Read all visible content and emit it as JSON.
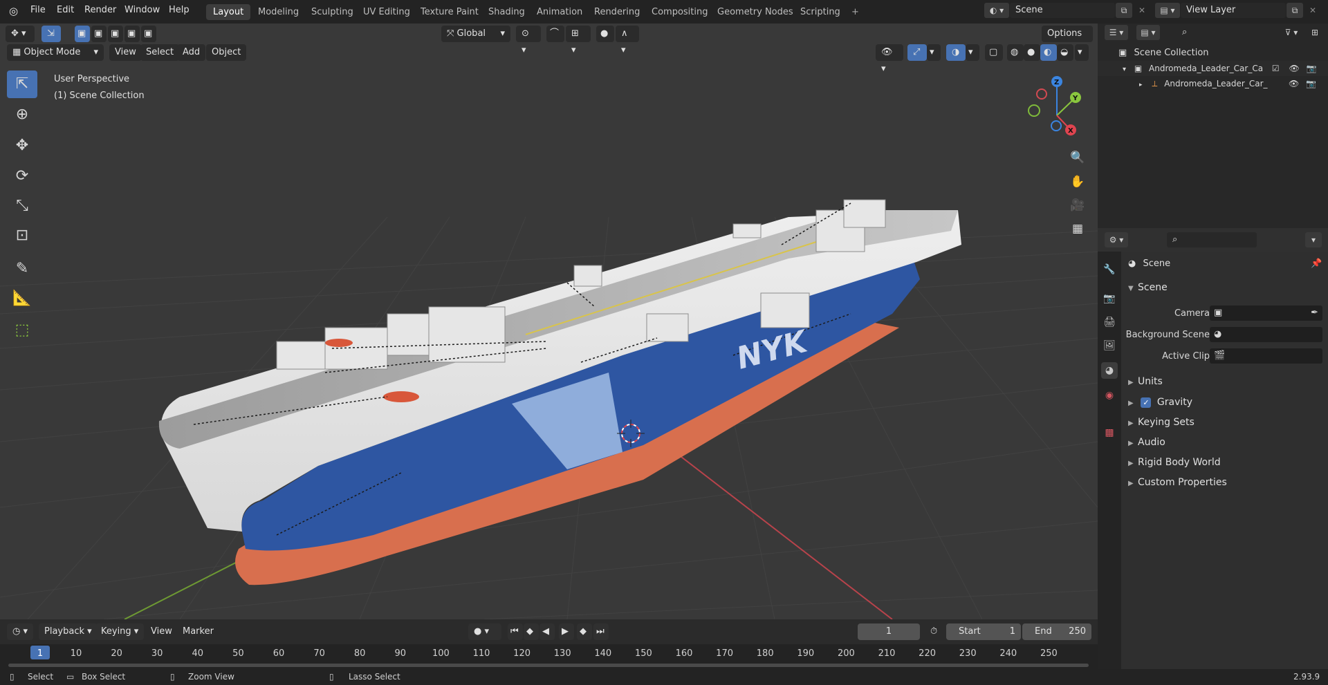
{
  "topbar": {
    "menus": [
      "File",
      "Edit",
      "Render",
      "Window",
      "Help"
    ],
    "workspaces": [
      "Layout",
      "Modeling",
      "Sculpting",
      "UV Editing",
      "Texture Paint",
      "Shading",
      "Animation",
      "Rendering",
      "Compositing",
      "Geometry Nodes",
      "Scripting"
    ],
    "add_tab": "+",
    "scene_name": "Scene",
    "view_layer_name": "View Layer"
  },
  "viewport": {
    "header": {
      "transform_orientation": "Global",
      "options": "Options",
      "mode": "Object Mode",
      "menus": [
        "View",
        "Select",
        "Add",
        "Object"
      ]
    },
    "overlay": {
      "line1": "User Perspective",
      "line2": "(1) Scene Collection"
    },
    "gizmo": {
      "x": "X",
      "y": "Y",
      "z": "Z"
    },
    "hull_text": "NYK"
  },
  "outliner": {
    "root": "Scene Collection",
    "items": [
      {
        "name": "Andromeda_Leader_Car_Carr"
      },
      {
        "name": "Andromeda_Leader_Car_"
      }
    ]
  },
  "properties": {
    "context": "Scene",
    "section": "Scene",
    "fields": [
      {
        "label": "Camera"
      },
      {
        "label": "Background Scene"
      },
      {
        "label": "Active Clip"
      }
    ],
    "subpanels": [
      "Units",
      "Gravity",
      "Keying Sets",
      "Audio",
      "Rigid Body World",
      "Custom Properties"
    ],
    "gravity_checked": true
  },
  "timeline": {
    "menus": [
      "Playback",
      "Keying",
      "View",
      "Marker"
    ],
    "current_frame": "1",
    "start_label": "Start",
    "start_value": "1",
    "end_label": "End",
    "end_value": "250",
    "ruler": [
      "1",
      "10",
      "20",
      "30",
      "40",
      "50",
      "60",
      "70",
      "80",
      "90",
      "100",
      "110",
      "120",
      "130",
      "140",
      "150",
      "160",
      "170",
      "180",
      "190",
      "200",
      "210",
      "220",
      "230",
      "240",
      "250"
    ]
  },
  "statusbar": {
    "hints": [
      "Select",
      "Box Select",
      "Zoom View",
      "Lasso Select"
    ],
    "version": "2.93.9"
  },
  "colors": {
    "accent": "#4772b3",
    "hull_red": "#d86f4e",
    "hull_blue": "#2e56a2",
    "axis_x": "#e0444f",
    "axis_y": "#8ac63e",
    "axis_z": "#3b85e0"
  }
}
